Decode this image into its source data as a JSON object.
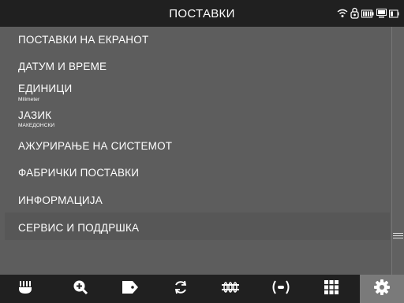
{
  "header": {
    "title": "ПОСТАВКИ",
    "status_icons": [
      "wifi-icon",
      "lock-icon",
      "battery-icon",
      "monitor-icon",
      "battery-small-icon"
    ]
  },
  "menu": {
    "items": [
      {
        "label": "ПОСТАВКИ НА ЕКРАНОТ"
      },
      {
        "label": "ДАТУМ И ВРЕМЕ"
      },
      {
        "label": "ЕДИНИЦИ",
        "sub": "Milimeter"
      },
      {
        "label": "ЈАЗИК",
        "sub": "МАКЕДОНСКИ"
      },
      {
        "label": "АЖУРИРАЊЕ НА СИСТЕМОТ"
      },
      {
        "label": "ФАБРИЧКИ ПОСТАВКИ"
      },
      {
        "label": "ИНФОРМАЦИЈА"
      },
      {
        "label": "СЕРВИС И ПОДДРШКА"
      }
    ]
  },
  "toolbar": {
    "buttons": [
      "probe-icon",
      "zoom-in-icon",
      "tag-icon",
      "refresh-icon",
      "bridge-icon",
      "signal-icon",
      "grid-icon",
      "settings-icon"
    ],
    "active": "settings-icon"
  },
  "colors": {
    "bar_background": "#202020",
    "menu_background": "#5d5d5d",
    "text": "#ffffff",
    "active_tab": "#7a7a7a"
  }
}
